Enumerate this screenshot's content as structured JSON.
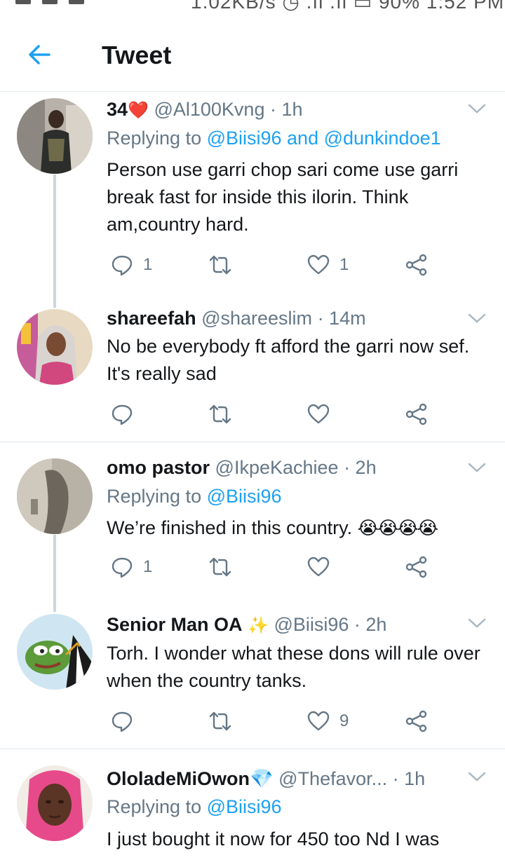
{
  "status_bar": {
    "text": "1.02KB/s ◷ .ıl .ıl ▭ 90% 1:52 PM"
  },
  "header": {
    "title": "Tweet",
    "back_icon": "arrow-left-icon"
  },
  "colors": {
    "accent": "#1da1f2",
    "muted": "#657786",
    "text": "#14171a",
    "divider": "#e1e8ed"
  },
  "tweets": [
    {
      "name": "34",
      "badge": "❤️",
      "handle": "@Al100Kvng",
      "time": "· 1h",
      "replying_prefix": "Replying to ",
      "replying_mentions": "@Biisi96 and @dunkindoe1",
      "text": "Person use garri chop sari come use garri break fast for inside this ilorin. Think am,country hard.",
      "reply_count": "1",
      "retweet_count": "",
      "like_count": "1"
    },
    {
      "name": "shareefah",
      "handle": "@shareeslim",
      "time": "· 14m",
      "text": "No be everybody ft afford the garri now sef. It's really sad",
      "reply_count": "",
      "retweet_count": "",
      "like_count": ""
    },
    {
      "name": "omo pastor",
      "handle": "@IkpeKachiee",
      "time": "· 2h",
      "replying_prefix": "Replying to ",
      "replying_mentions": "@Biisi96",
      "text": "We’re finished in this country.",
      "emoji": "😭😭😭😭",
      "reply_count": "1",
      "retweet_count": "",
      "like_count": ""
    },
    {
      "name": "Senior Man OA",
      "badge": "✨",
      "handle": "@Biisi96",
      "time": "· 2h",
      "text": "Torh. I wonder what these dons will rule over when the country tanks.",
      "reply_count": "",
      "retweet_count": "",
      "like_count": "9"
    },
    {
      "name": "OloladeMiOwon",
      "badge": "💎",
      "handle": "@Thefavor...",
      "time": "· 1h",
      "replying_prefix": "Replying to ",
      "replying_mentions": "@Biisi96",
      "text": "I just bought it now for 450 too Nd I was"
    }
  ]
}
